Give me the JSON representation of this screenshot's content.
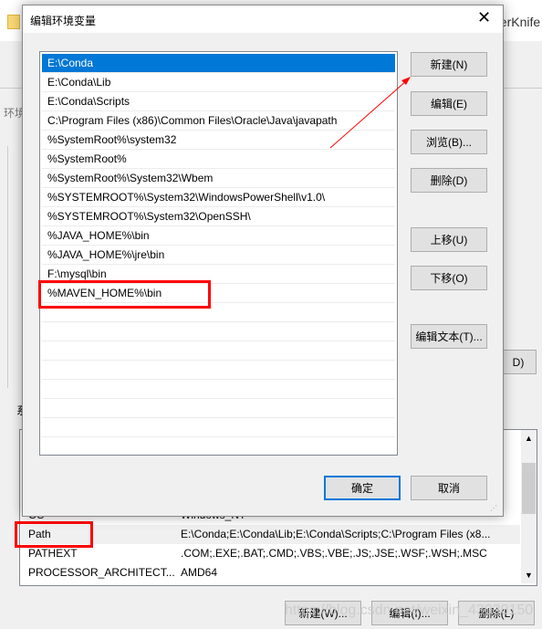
{
  "background": {
    "top_text": "tterKnife",
    "tab_label": "环境",
    "section_label": "系",
    "partial_button": "D)",
    "system_vars": [
      {
        "name": "OS",
        "value": "Windows_NT"
      },
      {
        "name": "Path",
        "value": "E:\\Conda;E:\\Conda\\Lib;E:\\Conda\\Scripts;C:\\Program Files (x8..."
      },
      {
        "name": "PATHEXT",
        "value": ".COM;.EXE;.BAT;.CMD;.VBS;.VBE;.JS;.JSE;.WSF;.WSH;.MSC"
      },
      {
        "name": "PROCESSOR_ARCHITECT...",
        "value": "AMD64"
      }
    ],
    "buttons": {
      "new": "新建(W)...",
      "edit": "编辑(I)...",
      "delete": "删除(L)"
    },
    "watermark": "https://blog.csdn.net/weixin_43030150"
  },
  "dialog": {
    "title": "编辑环境变量",
    "entries": [
      "E:\\Conda",
      "E:\\Conda\\Lib",
      "E:\\Conda\\Scripts",
      "C:\\Program Files (x86)\\Common Files\\Oracle\\Java\\javapath",
      "%SystemRoot%\\system32",
      "%SystemRoot%",
      "%SystemRoot%\\System32\\Wbem",
      "%SYSTEMROOT%\\System32\\WindowsPowerShell\\v1.0\\",
      "%SYSTEMROOT%\\System32\\OpenSSH\\",
      "%JAVA_HOME%\\bin",
      "%JAVA_HOME%\\jre\\bin",
      "F:\\mysql\\bin",
      "%MAVEN_HOME%\\bin"
    ],
    "selected_index": 0,
    "buttons": {
      "new": "新建(N)",
      "edit": "编辑(E)",
      "browse": "浏览(B)...",
      "delete": "删除(D)",
      "up": "上移(U)",
      "down": "下移(O)",
      "edit_text": "编辑文本(T)...",
      "ok": "确定",
      "cancel": "取消"
    }
  },
  "colors": {
    "selection": "#0078d7",
    "highlight": "#ff0000",
    "focus": "#0078d7"
  }
}
